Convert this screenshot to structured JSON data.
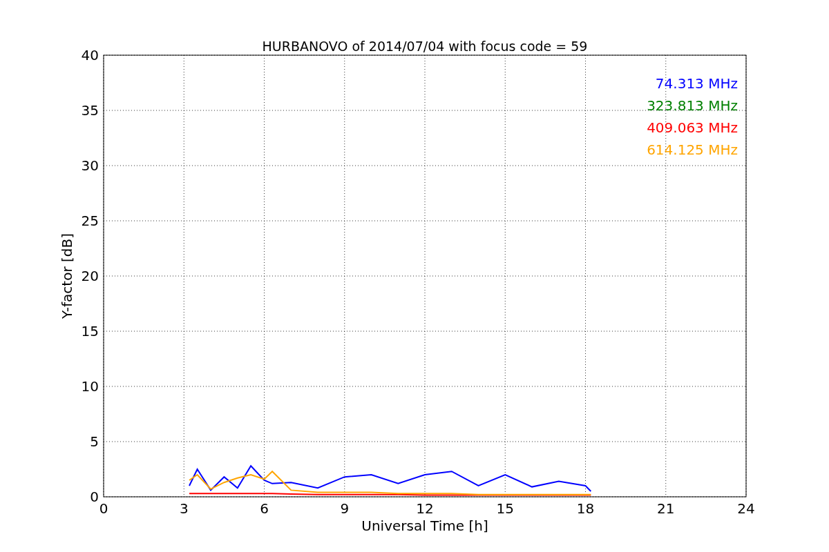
{
  "chart": {
    "chart_data": {
      "type": "line",
      "title": "HURBANOVO of 2014/07/04 with focus code = 59",
      "xlabel": "Universal Time [h]",
      "ylabel": "Y-factor [dB]",
      "x": [
        3.2,
        3.5,
        4,
        4.5,
        5,
        5.5,
        6,
        6.3,
        7,
        8,
        9,
        10,
        11,
        12,
        13,
        14,
        15,
        16,
        17,
        18,
        18.2
      ],
      "series": [
        {
          "name": "74.313 MHz",
          "color": "#0000ff",
          "values": [
            1.0,
            2.5,
            0.6,
            1.8,
            0.8,
            2.8,
            1.5,
            1.2,
            1.3,
            0.8,
            1.8,
            2.0,
            1.2,
            2.0,
            2.3,
            1.0,
            2.0,
            0.9,
            1.4,
            1.0,
            0.5
          ]
        },
        {
          "name": "323.813 MHz",
          "color": "#008000",
          "values": [
            null,
            null,
            null,
            null,
            null,
            null,
            null,
            null,
            null,
            null,
            null,
            null,
            null,
            null,
            null,
            null,
            null,
            null,
            null,
            null,
            null
          ]
        },
        {
          "name": "409.063 MHz",
          "color": "#ff0000",
          "values": [
            0.3,
            0.3,
            0.3,
            0.3,
            0.3,
            0.3,
            0.3,
            0.3,
            0.25,
            0.2,
            0.2,
            0.2,
            0.2,
            0.15,
            0.15,
            0.15,
            0.15,
            0.15,
            0.15,
            0.15,
            0.15
          ]
        },
        {
          "name": "614.125 MHz",
          "color": "#ffa500",
          "values": [
            1.5,
            2.0,
            0.7,
            1.3,
            1.7,
            2.0,
            1.6,
            2.3,
            0.6,
            0.4,
            0.4,
            0.4,
            0.3,
            0.3,
            0.3,
            0.2,
            0.2,
            0.2,
            0.2,
            0.2,
            0.2
          ]
        }
      ],
      "grid": true,
      "xlim": [
        0,
        24
      ],
      "ylim": [
        0,
        40
      ],
      "xticks": [
        0,
        3,
        6,
        9,
        12,
        15,
        18,
        21,
        24
      ],
      "yticks": [
        0,
        5,
        10,
        15,
        20,
        25,
        30,
        35,
        40
      ]
    }
  }
}
